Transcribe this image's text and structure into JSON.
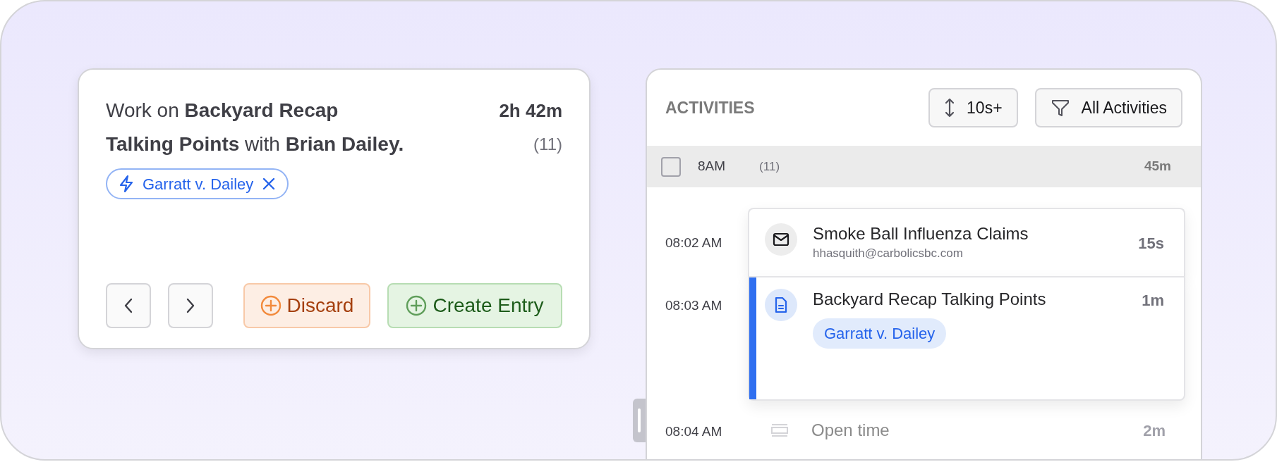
{
  "entry_card": {
    "title": "Work on **Backyard Recap Talking Points** with **Brian Dailey.**",
    "duration": "2h 42m",
    "count": "(11)",
    "tag": "Garratt v. Dailey",
    "buttons": [
      {
        "kind": "discard",
        "label": "Discard"
      },
      {
        "kind": "create",
        "label": "Create Entry"
      }
    ]
  },
  "activities": {
    "title": "ACTIVITIES",
    "filters": [
      {
        "kind": "sort",
        "label": "10s+"
      },
      {
        "kind": "filter",
        "label": "All Activities"
      }
    ],
    "group": {
      "checked": false,
      "hour": "8AM",
      "count": "(11)",
      "duration": "45m"
    },
    "entries": [
      {
        "kind": "email",
        "time": "08:02 AM",
        "title": "Smoke Ball Influenza Claims",
        "subtitle": "hhasquith@carbolicsbc.com",
        "duration": "15s",
        "selected": false
      },
      {
        "kind": "document",
        "time": "08:03 AM",
        "title": "Backyard Recap Talking Points",
        "tag": "Garratt v. Dailey",
        "duration": "1m",
        "selected": true
      },
      {
        "kind": "open",
        "time": "08:04 AM",
        "title": "Open time",
        "duration": "2m",
        "selected": false
      }
    ]
  }
}
